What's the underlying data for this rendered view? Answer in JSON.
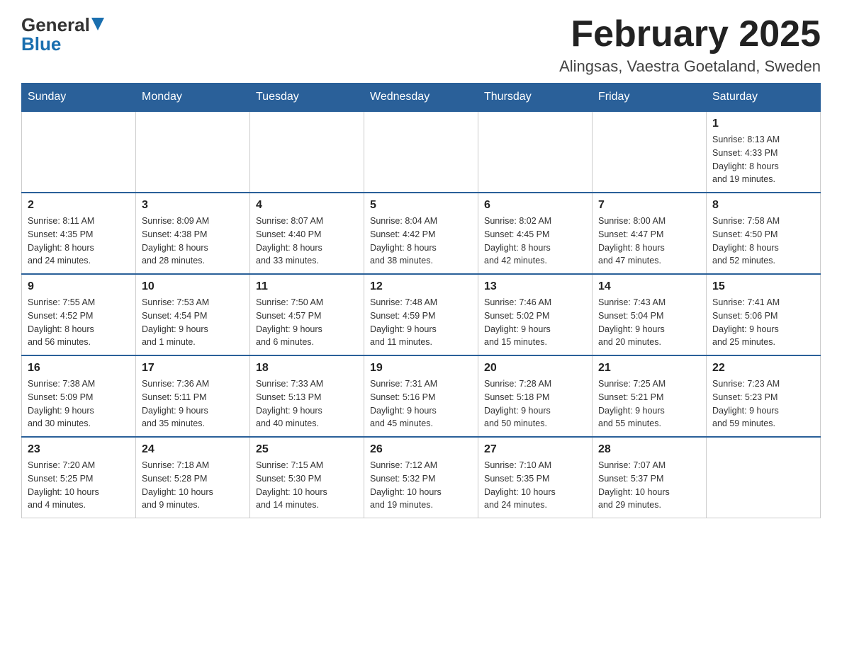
{
  "header": {
    "logo": {
      "general": "General",
      "blue": "Blue"
    },
    "title": "February 2025",
    "location": "Alingsas, Vaestra Goetaland, Sweden"
  },
  "calendar": {
    "days_of_week": [
      "Sunday",
      "Monday",
      "Tuesday",
      "Wednesday",
      "Thursday",
      "Friday",
      "Saturday"
    ],
    "weeks": [
      {
        "days": [
          {
            "number": "",
            "info": ""
          },
          {
            "number": "",
            "info": ""
          },
          {
            "number": "",
            "info": ""
          },
          {
            "number": "",
            "info": ""
          },
          {
            "number": "",
            "info": ""
          },
          {
            "number": "",
            "info": ""
          },
          {
            "number": "1",
            "info": "Sunrise: 8:13 AM\nSunset: 4:33 PM\nDaylight: 8 hours\nand 19 minutes."
          }
        ]
      },
      {
        "days": [
          {
            "number": "2",
            "info": "Sunrise: 8:11 AM\nSunset: 4:35 PM\nDaylight: 8 hours\nand 24 minutes."
          },
          {
            "number": "3",
            "info": "Sunrise: 8:09 AM\nSunset: 4:38 PM\nDaylight: 8 hours\nand 28 minutes."
          },
          {
            "number": "4",
            "info": "Sunrise: 8:07 AM\nSunset: 4:40 PM\nDaylight: 8 hours\nand 33 minutes."
          },
          {
            "number": "5",
            "info": "Sunrise: 8:04 AM\nSunset: 4:42 PM\nDaylight: 8 hours\nand 38 minutes."
          },
          {
            "number": "6",
            "info": "Sunrise: 8:02 AM\nSunset: 4:45 PM\nDaylight: 8 hours\nand 42 minutes."
          },
          {
            "number": "7",
            "info": "Sunrise: 8:00 AM\nSunset: 4:47 PM\nDaylight: 8 hours\nand 47 minutes."
          },
          {
            "number": "8",
            "info": "Sunrise: 7:58 AM\nSunset: 4:50 PM\nDaylight: 8 hours\nand 52 minutes."
          }
        ]
      },
      {
        "days": [
          {
            "number": "9",
            "info": "Sunrise: 7:55 AM\nSunset: 4:52 PM\nDaylight: 8 hours\nand 56 minutes."
          },
          {
            "number": "10",
            "info": "Sunrise: 7:53 AM\nSunset: 4:54 PM\nDaylight: 9 hours\nand 1 minute."
          },
          {
            "number": "11",
            "info": "Sunrise: 7:50 AM\nSunset: 4:57 PM\nDaylight: 9 hours\nand 6 minutes."
          },
          {
            "number": "12",
            "info": "Sunrise: 7:48 AM\nSunset: 4:59 PM\nDaylight: 9 hours\nand 11 minutes."
          },
          {
            "number": "13",
            "info": "Sunrise: 7:46 AM\nSunset: 5:02 PM\nDaylight: 9 hours\nand 15 minutes."
          },
          {
            "number": "14",
            "info": "Sunrise: 7:43 AM\nSunset: 5:04 PM\nDaylight: 9 hours\nand 20 minutes."
          },
          {
            "number": "15",
            "info": "Sunrise: 7:41 AM\nSunset: 5:06 PM\nDaylight: 9 hours\nand 25 minutes."
          }
        ]
      },
      {
        "days": [
          {
            "number": "16",
            "info": "Sunrise: 7:38 AM\nSunset: 5:09 PM\nDaylight: 9 hours\nand 30 minutes."
          },
          {
            "number": "17",
            "info": "Sunrise: 7:36 AM\nSunset: 5:11 PM\nDaylight: 9 hours\nand 35 minutes."
          },
          {
            "number": "18",
            "info": "Sunrise: 7:33 AM\nSunset: 5:13 PM\nDaylight: 9 hours\nand 40 minutes."
          },
          {
            "number": "19",
            "info": "Sunrise: 7:31 AM\nSunset: 5:16 PM\nDaylight: 9 hours\nand 45 minutes."
          },
          {
            "number": "20",
            "info": "Sunrise: 7:28 AM\nSunset: 5:18 PM\nDaylight: 9 hours\nand 50 minutes."
          },
          {
            "number": "21",
            "info": "Sunrise: 7:25 AM\nSunset: 5:21 PM\nDaylight: 9 hours\nand 55 minutes."
          },
          {
            "number": "22",
            "info": "Sunrise: 7:23 AM\nSunset: 5:23 PM\nDaylight: 9 hours\nand 59 minutes."
          }
        ]
      },
      {
        "days": [
          {
            "number": "23",
            "info": "Sunrise: 7:20 AM\nSunset: 5:25 PM\nDaylight: 10 hours\nand 4 minutes."
          },
          {
            "number": "24",
            "info": "Sunrise: 7:18 AM\nSunset: 5:28 PM\nDaylight: 10 hours\nand 9 minutes."
          },
          {
            "number": "25",
            "info": "Sunrise: 7:15 AM\nSunset: 5:30 PM\nDaylight: 10 hours\nand 14 minutes."
          },
          {
            "number": "26",
            "info": "Sunrise: 7:12 AM\nSunset: 5:32 PM\nDaylight: 10 hours\nand 19 minutes."
          },
          {
            "number": "27",
            "info": "Sunrise: 7:10 AM\nSunset: 5:35 PM\nDaylight: 10 hours\nand 24 minutes."
          },
          {
            "number": "28",
            "info": "Sunrise: 7:07 AM\nSunset: 5:37 PM\nDaylight: 10 hours\nand 29 minutes."
          },
          {
            "number": "",
            "info": ""
          }
        ]
      }
    ]
  }
}
